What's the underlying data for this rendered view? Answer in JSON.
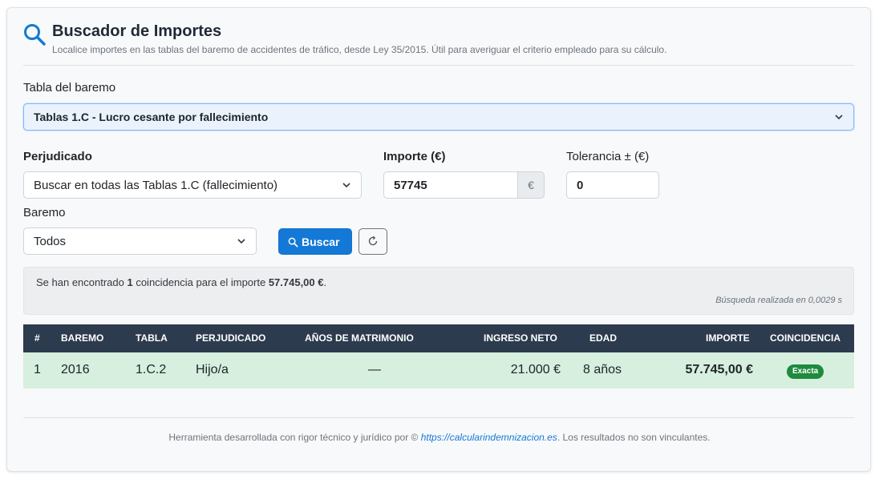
{
  "header": {
    "icon": "search-icon",
    "title": "Buscador de Importes",
    "subtitle": "Localice importes en las tablas del baremo de accidentes de tráfico, desde Ley 35/2015. Útil para averiguar el criterio empleado para su cálculo."
  },
  "form": {
    "tabla_label": "Tabla del baremo",
    "tabla_value": "Tablas 1.C - Lucro cesante por fallecimiento",
    "perjudicado_label": "Perjudicado",
    "perjudicado_value": "Buscar en todas las Tablas 1.C (fallecimiento)",
    "importe_label": "Importe (€)",
    "importe_value": "57745",
    "importe_addon": "€",
    "tolerancia_label": "Tolerancia ± (€)",
    "tolerancia_value": "0",
    "baremo_label": "Baremo",
    "baremo_value": "Todos",
    "search_button": "Buscar",
    "reset_icon": "refresh-icon"
  },
  "result_info": {
    "prefix": "Se han encontrado ",
    "count": "1",
    "middle": " coincidencia para el importe ",
    "amount": "57.745,00 €",
    "suffix": ".",
    "time": "Búsqueda realizada en 0,0029 s"
  },
  "table": {
    "headers": [
      "#",
      "BAREMO",
      "TABLA",
      "PERJUDICADO",
      "AÑOS DE MATRIMONIO",
      "INGRESO NETO",
      "EDAD",
      "IMPORTE",
      "COINCIDENCIA"
    ],
    "rows": [
      {
        "num": "1",
        "baremo": "2016",
        "tabla": "1.C.2",
        "perjudicado": "Hijo/a",
        "anos": "—",
        "ingreso": "21.000 €",
        "edad": "8 años",
        "importe": "57.745,00 €",
        "coincidencia": "Exacta"
      }
    ]
  },
  "footer": {
    "prefix": "Herramienta desarrollada con rigor técnico y jurídico por © ",
    "link": "https://calcularindemnizacion.es",
    "suffix": ". Los resultados no son vinculantes."
  },
  "colors": {
    "accent": "#1479d6",
    "table_header": "#2c3b4d",
    "row_match": "#d6efdf",
    "badge": "#1e8a3e"
  }
}
